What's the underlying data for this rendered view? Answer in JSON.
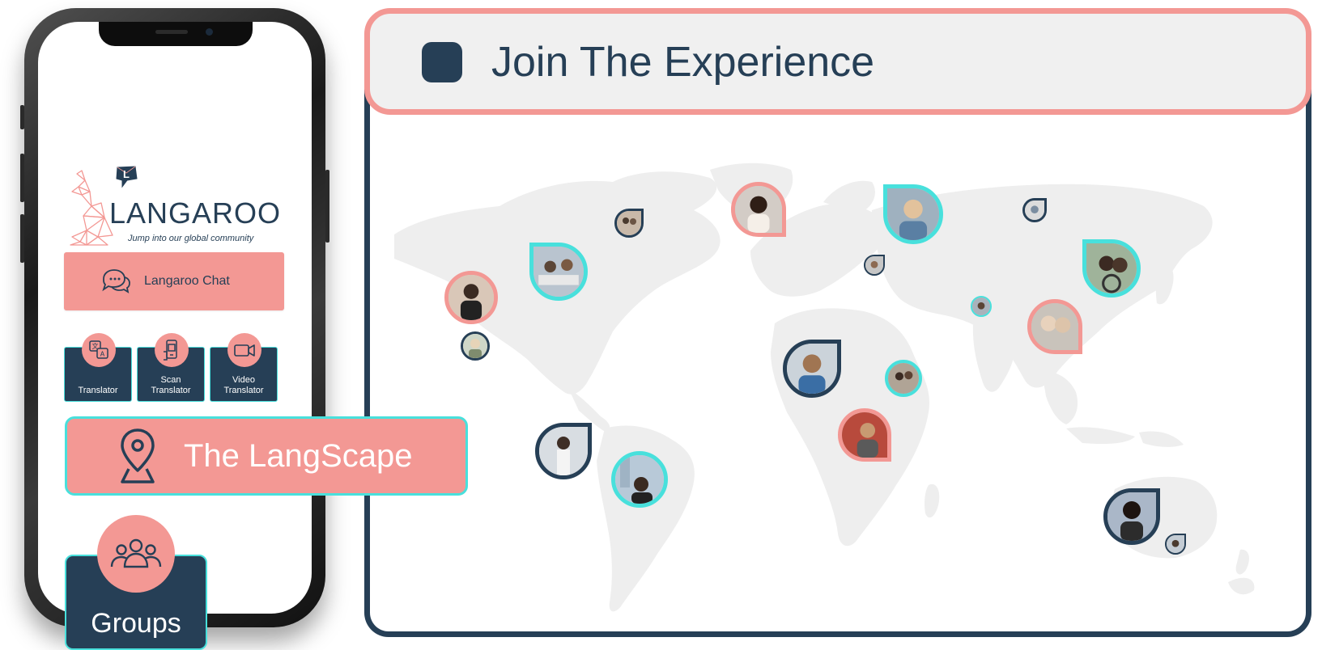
{
  "colors": {
    "navy": "#263f56",
    "coral": "#f39894",
    "teal": "#48e0dc",
    "panel_bg": "#f0f0f0",
    "map_land": "#eeeeee"
  },
  "phone": {
    "logo": {
      "letter": "L",
      "name": "LANGAROO",
      "tagline": "Jump into our global community",
      "icon": "kangaroo-icon"
    },
    "chat_button": {
      "label": "Langaroo Chat",
      "icon": "chat-bubbles-icon"
    },
    "tiles": [
      {
        "label": "Translator",
        "icon": "translate-icon"
      },
      {
        "label": "Scan\nTranslator",
        "icon": "scan-phone-icon"
      },
      {
        "label": "Video\nTranslator",
        "icon": "video-camera-icon"
      }
    ]
  },
  "langscape": {
    "label": "The LangScape",
    "icon": "map-pin-icon"
  },
  "groups": {
    "label": "Groups",
    "icon": "people-group-icon"
  },
  "header": {
    "title": "Join The Experience"
  },
  "map": {
    "avatars": [
      {
        "ring": "coral",
        "shape": "round"
      },
      {
        "ring": "navy",
        "shape": "round"
      },
      {
        "ring": "teal",
        "shape": "round"
      },
      {
        "ring": "navy",
        "shape": "round"
      },
      {
        "ring": "coral",
        "shape": "teardrop"
      },
      {
        "ring": "teal",
        "shape": "teardrop"
      },
      {
        "ring": "navy",
        "shape": "round"
      },
      {
        "ring": "navy",
        "shape": "teardrop"
      },
      {
        "ring": "teal",
        "shape": "teardrop"
      },
      {
        "ring": "teal",
        "shape": "round"
      },
      {
        "ring": "coral",
        "shape": "teardrop"
      },
      {
        "ring": "navy",
        "shape": "teardrop"
      },
      {
        "ring": "teal",
        "shape": "round"
      },
      {
        "ring": "coral",
        "shape": "teardrop"
      },
      {
        "ring": "navy",
        "shape": "round"
      },
      {
        "ring": "navy",
        "shape": "teardrop"
      },
      {
        "ring": "teal",
        "shape": "teardrop"
      },
      {
        "ring": "navy",
        "shape": "teardrop"
      },
      {
        "ring": "coral",
        "shape": "teardrop"
      },
      {
        "ring": "navy",
        "shape": "teardrop"
      },
      {
        "ring": "navy",
        "shape": "teardrop"
      }
    ]
  }
}
